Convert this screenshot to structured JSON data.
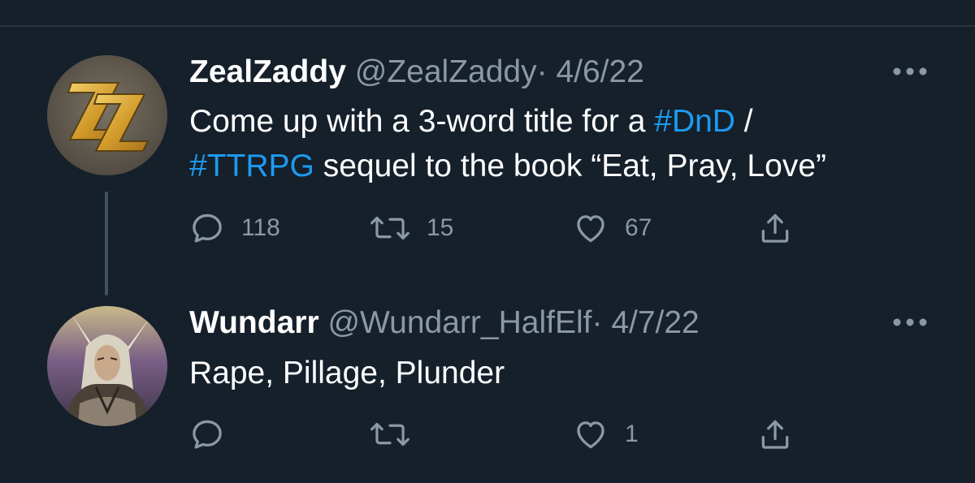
{
  "theme": {
    "background": "#15202b",
    "text": "#ffffff",
    "secondary_text": "#8b98a5",
    "link": "#1d9bf0",
    "thread_line": "#3d5466",
    "avatar_1_bg": "#6c6457",
    "avatar_1_logo": "#d9a93a"
  },
  "tweets": [
    {
      "display_name": "ZealZaddy",
      "handle": "@ZealZaddy",
      "separator": "·",
      "date": "4/6/22",
      "avatar_icon": "zz-monogram-logo",
      "text_line1_a": "Come up with a 3-word title for a ",
      "hashtag_1": "#DnD",
      "text_line1_b": " /",
      "hashtag_2": "#TTRPG",
      "text_line2_b": " sequel to the book “Eat, Pray, Love”",
      "replies": "118",
      "retweets": "15",
      "likes": "67"
    },
    {
      "display_name": "Wundarr",
      "handle": "@Wundarr_HalfElf",
      "separator": "·",
      "date": "4/7/22",
      "avatar_icon": "elf-character-portrait",
      "text": "Rape, Pillage, Plunder",
      "replies": "",
      "retweets": "",
      "likes": "1"
    }
  ],
  "icons": {
    "reply": "reply-bubble-icon",
    "retweet": "retweet-icon",
    "like": "heart-icon",
    "share": "share-icon",
    "more": "more-dots-icon"
  }
}
